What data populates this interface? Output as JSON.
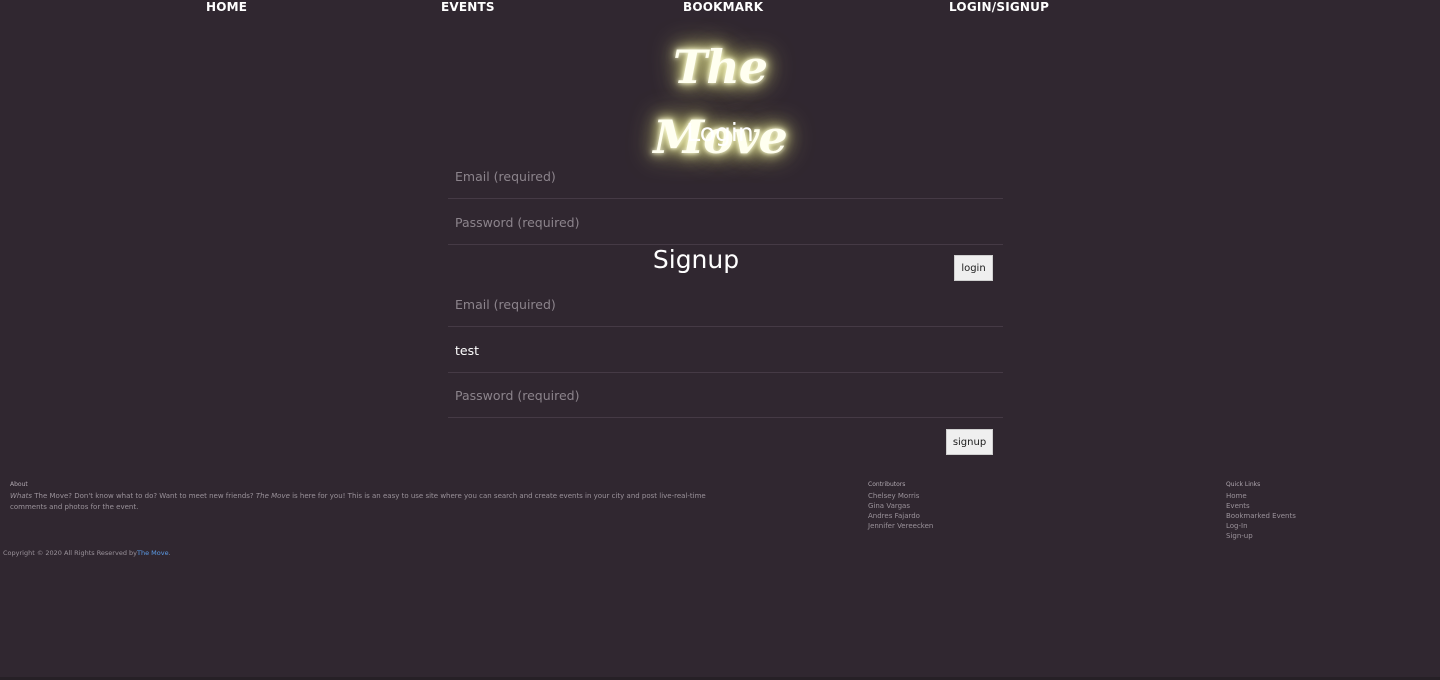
{
  "nav": {
    "home": "HOME",
    "events": "EVENTS",
    "bookmark": "BOOKMARK",
    "login_signup": "LOGIN/SIGNUP"
  },
  "logo": {
    "text": "The Move"
  },
  "login": {
    "title": "Login",
    "email_placeholder": "Email (required)",
    "email_value": "",
    "password_placeholder": "Password (required)",
    "password_value": "",
    "button_label": "login"
  },
  "signup": {
    "title": "Signup",
    "email_placeholder": "Email (required)",
    "email_value": "",
    "username_value": "test",
    "password_placeholder": "Password (required)",
    "password_value": "",
    "button_label": "signup"
  },
  "footer": {
    "about": {
      "heading": "About",
      "text_em1": "Whats",
      "text_1": " The Move? Don't know what to do? Want to meet new friends? ",
      "text_em2": "The Move",
      "text_2": " is here for you! This is an easy to use site where you can search and create events in your city and post live-real-time comments and photos for the event."
    },
    "contributors": {
      "heading": "Contributors",
      "names": [
        "Chelsey Morris",
        "Gina Vargas",
        "Andres Fajardo",
        "Jennifer Vereecken"
      ]
    },
    "quick_links": {
      "heading": "Quick Links",
      "links": [
        "Home",
        "Events",
        "Bookmarked Events",
        "Log-In",
        "Sign-up"
      ]
    },
    "copyright": {
      "text": "Copyright © 2020 All Rights Reserved by",
      "link": "The Move",
      "suffix": "."
    }
  },
  "colors": {
    "background": "#302730",
    "logo_glow": "#f5f5b0",
    "link": "#5b9be6",
    "button_bg": "#efefef"
  }
}
